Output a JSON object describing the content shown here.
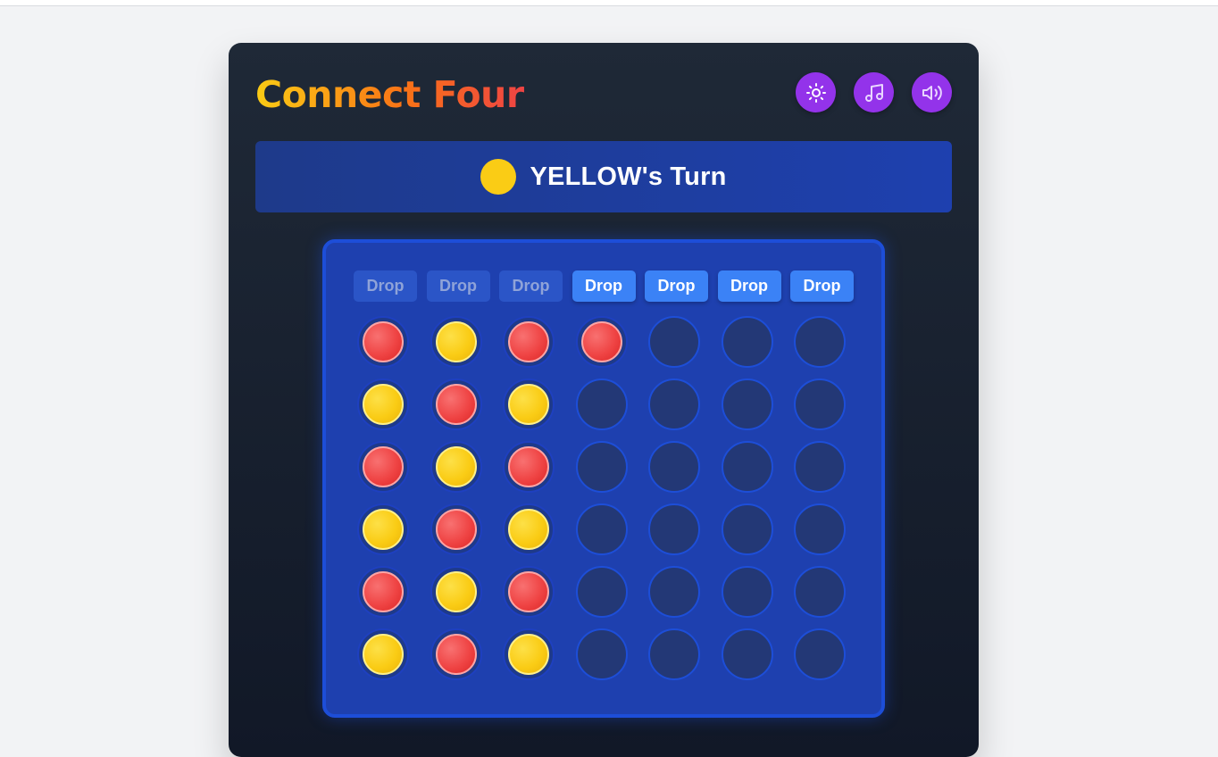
{
  "game": {
    "title": "Connect Four",
    "current_player": "yellow",
    "turn_text": "YELLOW's Turn"
  },
  "controls": [
    {
      "name": "theme-toggle",
      "icon": "sun-icon"
    },
    {
      "name": "music-toggle",
      "icon": "music-note-icon"
    },
    {
      "name": "sound-toggle",
      "icon": "volume-icon"
    }
  ],
  "columns": [
    {
      "label": "Drop",
      "enabled": false
    },
    {
      "label": "Drop",
      "enabled": false
    },
    {
      "label": "Drop",
      "enabled": false
    },
    {
      "label": "Drop",
      "enabled": true
    },
    {
      "label": "Drop",
      "enabled": true
    },
    {
      "label": "Drop",
      "enabled": true
    },
    {
      "label": "Drop",
      "enabled": true
    }
  ],
  "board": [
    [
      "red",
      "yellow",
      "red",
      "red",
      null,
      null,
      null
    ],
    [
      "yellow",
      "red",
      "yellow",
      null,
      null,
      null,
      null
    ],
    [
      "red",
      "yellow",
      "red",
      null,
      null,
      null,
      null
    ],
    [
      "yellow",
      "red",
      "yellow",
      null,
      null,
      null,
      null
    ],
    [
      "red",
      "yellow",
      "red",
      null,
      null,
      null,
      null
    ],
    [
      "yellow",
      "red",
      "yellow",
      null,
      null,
      null,
      null
    ]
  ],
  "colors": {
    "red": "#ef4444",
    "yellow": "#facc15",
    "board": "#1e40af",
    "accent": "#9333ea"
  }
}
